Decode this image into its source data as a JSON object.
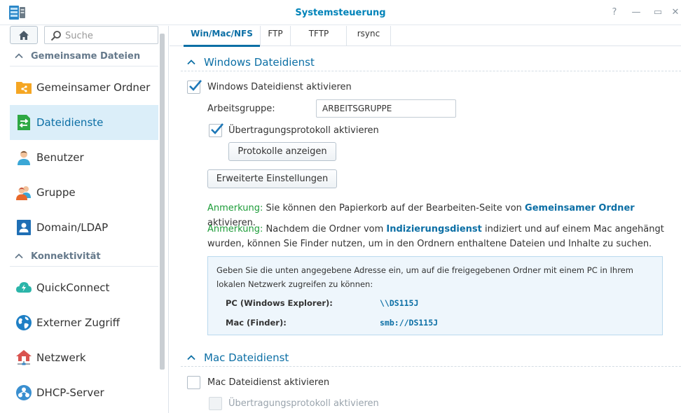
{
  "window": {
    "title": "Systemsteuerung",
    "buttons": {
      "help": "?",
      "minimize": "—",
      "maximize": "▭",
      "close": "✕"
    }
  },
  "sidebar": {
    "search_placeholder": "Suche",
    "sections": [
      {
        "label": "Gemeinsame Dateien"
      },
      {
        "label": "Konnektivität"
      }
    ],
    "items": [
      {
        "label": "Gemeinsamer Ordner",
        "icon": "shared-folder-icon"
      },
      {
        "label": "Dateidienste",
        "icon": "file-services-icon",
        "active": true
      },
      {
        "label": "Benutzer",
        "icon": "user-icon"
      },
      {
        "label": "Gruppe",
        "icon": "group-icon"
      },
      {
        "label": "Domain/LDAP",
        "icon": "domain-icon"
      },
      {
        "label": "QuickConnect",
        "icon": "quickconnect-icon"
      },
      {
        "label": "Externer Zugriff",
        "icon": "globe-icon"
      },
      {
        "label": "Netzwerk",
        "icon": "network-icon"
      },
      {
        "label": "DHCP-Server",
        "icon": "dhcp-icon"
      }
    ]
  },
  "tabs": [
    {
      "label": "Win/Mac/NFS",
      "active": true
    },
    {
      "label": "FTP"
    },
    {
      "label": "TFTP"
    },
    {
      "label": "rsync"
    }
  ],
  "windows_section": {
    "title": "Windows Dateidienst",
    "enable_label": "Windows Dateidienst aktivieren",
    "enable_checked": true,
    "workgroup_label": "Arbeitsgruppe:",
    "workgroup_value": "ARBEITSGRUPPE",
    "transfer_log_label": "Übertragungsprotokoll aktivieren",
    "transfer_log_checked": true,
    "show_logs_button": "Protokolle anzeigen",
    "advanced_button": "Erweiterte Einstellungen",
    "note1": {
      "prefix": "Anmerkung:",
      "text_before": " Sie können den Papierkorb auf der Bearbeiten-Seite von ",
      "link": "Gemeinsamer Ordner",
      "text_after": " aktivieren."
    },
    "note2": {
      "prefix": "Anmerkung:",
      "text_before": " Nachdem die Ordner vom ",
      "link": "Indizierungsdienst",
      "text_after": " indiziert und auf einem Mac angehängt wurden, können Sie Finder nutzen, um in den Ordnern enthaltene Dateien und Inhalte zu suchen."
    },
    "info": {
      "text": "Geben Sie die unten angegebene Adresse ein, um auf die freigegebenen Ordner mit einem PC in Ihrem lokalen Netzwerk zugreifen zu können:",
      "pc_label": "PC (Windows Explorer):",
      "pc_value": "\\\\DS115J",
      "mac_label": "Mac (Finder):",
      "mac_value": "smb://DS115J"
    }
  },
  "mac_section": {
    "title": "Mac Dateidienst",
    "enable_label": "Mac Dateidienst aktivieren",
    "enable_checked": false,
    "transfer_log_label": "Übertragungsprotokoll aktivieren",
    "transfer_log_checked": false
  },
  "colors": {
    "accent": "#0c6fa5",
    "title": "#0083b9",
    "note_green": "#1c9c38",
    "active_bg": "#dbeef9"
  }
}
